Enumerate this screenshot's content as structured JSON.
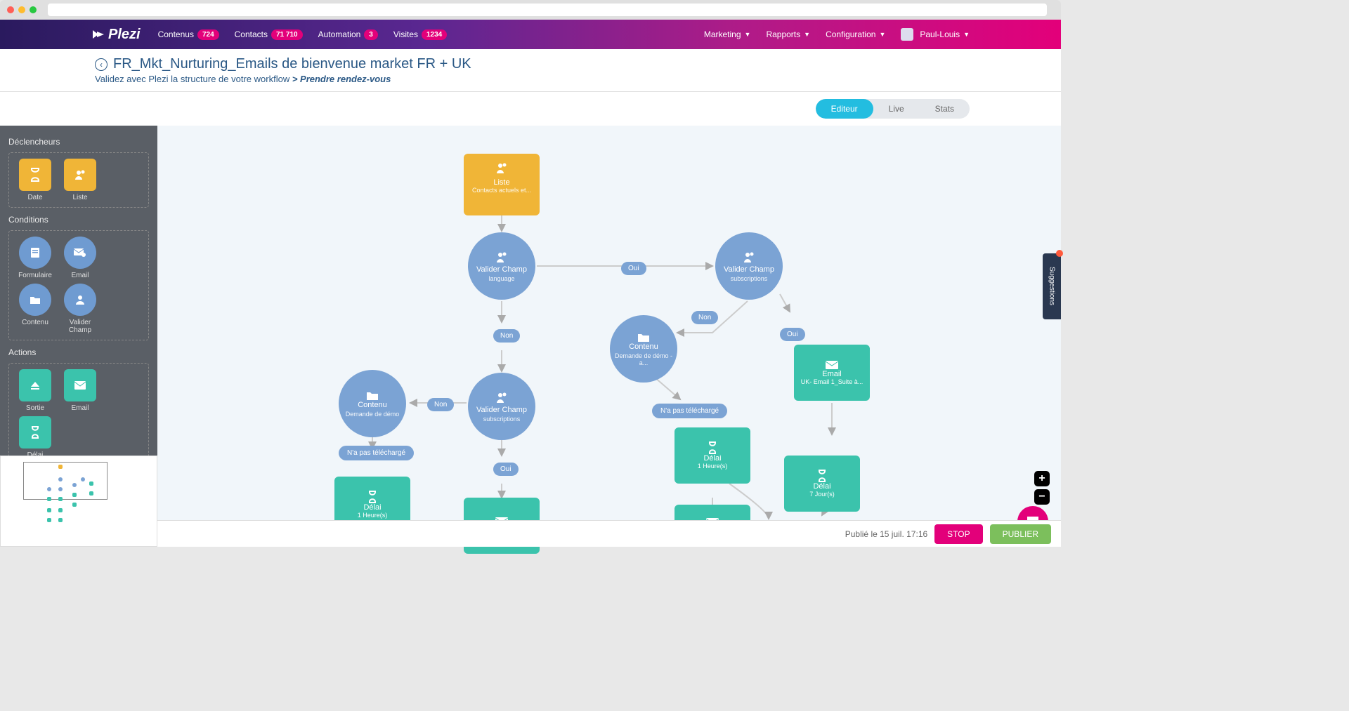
{
  "nav": {
    "logo": "Plezi",
    "items": [
      {
        "label": "Contenus",
        "badge": "724"
      },
      {
        "label": "Contacts",
        "badge": "71 710"
      },
      {
        "label": "Automation",
        "badge": "3"
      },
      {
        "label": "Visites",
        "badge": "1234"
      }
    ],
    "right": [
      "Marketing",
      "Rapports",
      "Configuration"
    ],
    "user": "Paul-Louis"
  },
  "header": {
    "title": "FR_Mkt_Nurturing_Emails de bienvenue market FR + UK",
    "subLead": "Validez avec Plezi la structure de votre workflow ",
    "subAction": "> Prendre rendez-vous"
  },
  "tabs": {
    "editor": "Editeur",
    "live": "Live",
    "stats": "Stats"
  },
  "sidebar": {
    "triggers_title": "Déclencheurs",
    "triggers": [
      {
        "label": "Date"
      },
      {
        "label": "Liste"
      }
    ],
    "conditions_title": "Conditions",
    "conditions": [
      {
        "label": "Formulaire"
      },
      {
        "label": "Email"
      },
      {
        "label": "Contenu"
      },
      {
        "label": "Valider Champ"
      }
    ],
    "actions_title": "Actions",
    "actions": [
      {
        "label": "Sortie"
      },
      {
        "label": "Email"
      },
      {
        "label": "Délai"
      }
    ]
  },
  "nodes": {
    "liste": {
      "t": "Liste",
      "s": "Contacts actuels et..."
    },
    "valider1": {
      "t": "Valider Champ",
      "s": "language"
    },
    "valider2": {
      "t": "Valider Champ",
      "s": "subscriptions"
    },
    "valider3": {
      "t": "Valider Champ",
      "s": "subscriptions"
    },
    "contenu1": {
      "t": "Contenu",
      "s": "Demande de démo"
    },
    "contenu2": {
      "t": "Contenu",
      "s": "Demande de démo - a..."
    },
    "email1": {
      "t": "Email",
      "s": "UK- Email 1_Suite à..."
    },
    "email2": {
      "t": "Email",
      "s": ""
    },
    "email3": {
      "t": "Email",
      "s": ""
    },
    "delai1": {
      "t": "Délai",
      "s": "1 Heure(s)"
    },
    "delai2": {
      "t": "Délai",
      "s": "1 Heure(s)"
    },
    "delai3": {
      "t": "Délai",
      "s": "7 Jour(s)"
    }
  },
  "pills": {
    "oui": "Oui",
    "non": "Non",
    "npt": "N'a pas téléchargé"
  },
  "footer": {
    "published": "Publié le 15 juil. 17:16",
    "stop": "STOP",
    "publish": "PUBLIER"
  },
  "suggestions": "Suggestions"
}
